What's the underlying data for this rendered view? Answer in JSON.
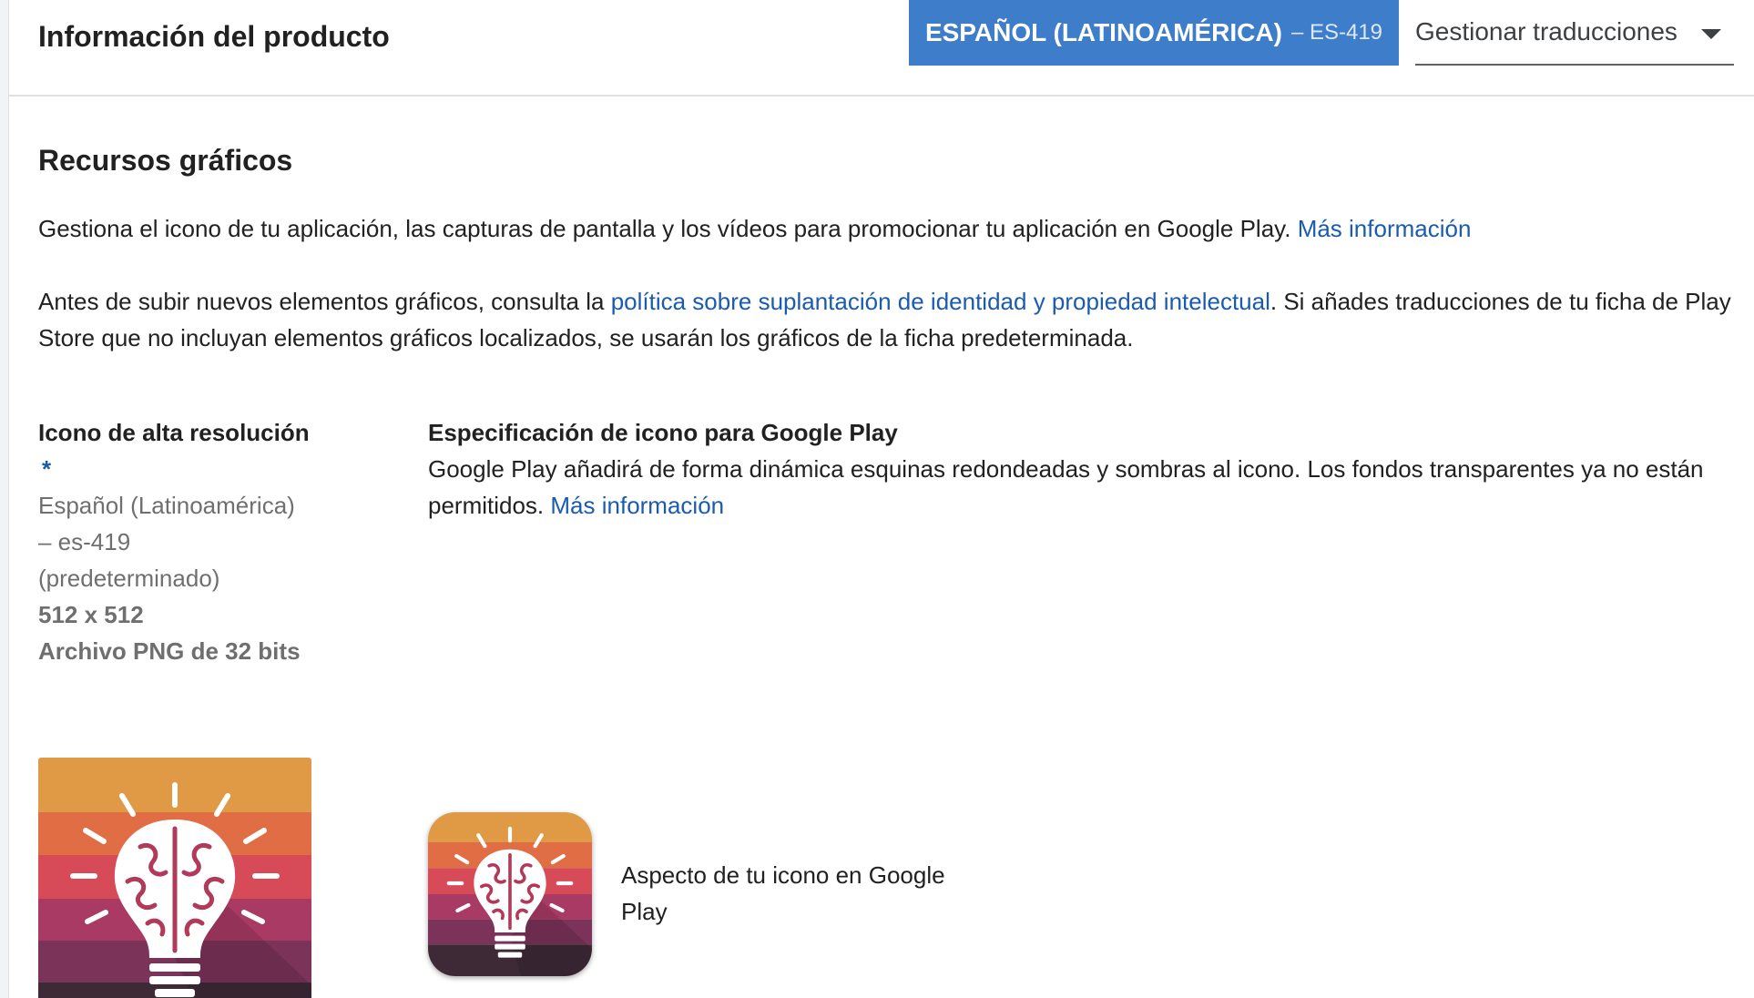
{
  "header": {
    "title": "Información del producto",
    "language_button": {
      "label": "ESPAÑOL (LATINOAMÉRICA)",
      "code": "– ES-419"
    },
    "manage_translations": {
      "label": "Gestionar traducciones",
      "icon": "chevron-down-icon"
    }
  },
  "graphics": {
    "title": "Recursos gráficos",
    "intro_text": "Gestiona el icono de tu aplicación, las capturas de pantalla y los vídeos para promocionar tu aplicación en Google Play.",
    "intro_link": "Más información",
    "policy_text_before": "Antes de subir nuevos elementos gráficos, consulta la",
    "policy_link": "política sobre suplantación de identidad y propiedad intelectual",
    "policy_text_after": ". Si añades traducciones de tu ficha de Play Store que no incluyan elementos gráficos localizados, se usarán los gráficos de la ficha predeterminada."
  },
  "icon_field": {
    "title": "Icono de alta resolución",
    "required_mark": "*",
    "language": "Español (Latinoamérica) – es-419 (predeterminado)",
    "dimensions": "512 x 512",
    "format": "Archivo PNG de 32 bits"
  },
  "icon_spec": {
    "title": "Especificación de icono para Google Play",
    "text": "Google Play añadirá de forma dinámica esquinas redondeadas y sombras al icono. Los fondos transparentes ya no están permitidos.",
    "link": "Más información"
  },
  "preview": {
    "caption": "Aspecto de tu icono en Google Play",
    "stripe_colors": [
      "#e09a45",
      "#e06d44",
      "#d74a58",
      "#a93a63",
      "#7b3359",
      "#3e2a37"
    ]
  },
  "colors": {
    "primary_button": "#3d7dca",
    "link": "#1a5bb0"
  }
}
